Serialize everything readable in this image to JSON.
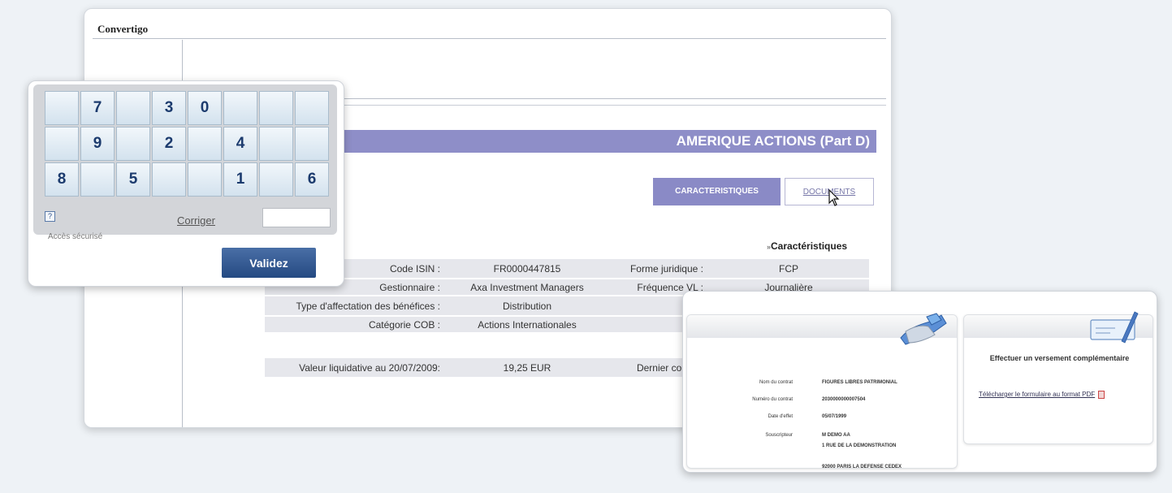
{
  "app": {
    "title": "Convertigo"
  },
  "fund": {
    "name": "AMERIQUE ACTIONS (Part D)",
    "tabs": [
      {
        "label": "CARACTERISTIQUES",
        "active": true
      },
      {
        "label": "DOCUMENTS",
        "active": false
      }
    ],
    "section_title": "Caractéristiques",
    "rows": [
      {
        "label": "Code ISIN :",
        "value": "FR0000447815",
        "label2": "Forme juridique :",
        "value2": "FCP"
      },
      {
        "label": "Gestionnaire :",
        "value": "Axa Investment Managers",
        "label2": "Fréquence VL :",
        "value2": "Journalière"
      },
      {
        "label": "Type d'affectation des bénéfices :",
        "value": "Distribution",
        "label2": "",
        "value2": ""
      },
      {
        "label": "Catégorie COB :",
        "value": "Actions Internationales",
        "label2": "",
        "value2": ""
      }
    ],
    "vl_row": {
      "label": "Valeur liquidative au 20/07/2009:",
      "value": "19,25 EUR",
      "label2": "Dernier coupon",
      "value2": ""
    }
  },
  "keypad": {
    "rows": [
      [
        "",
        "7",
        "",
        "3",
        "0",
        "",
        "",
        ""
      ],
      [
        "",
        "9",
        "",
        "2",
        "",
        "4",
        "",
        ""
      ],
      [
        "8",
        "",
        "5",
        "",
        "",
        "1",
        "",
        "6"
      ]
    ],
    "help_label": "?",
    "secure_label": "Accès sécurisé",
    "corriger_label": "Corriger",
    "code_value": "",
    "validate_label": "Validez"
  },
  "contract": {
    "rows": [
      {
        "key": "Nom du contrat",
        "value": "FIGURES LIBRES PATRIMONIAL"
      },
      {
        "key": "Numéro du contrat",
        "value": "2030000000007504"
      },
      {
        "key": "Date d'effet",
        "value": "05/07/1999"
      },
      {
        "key": "Souscripteur",
        "value": "M DEMO AA"
      }
    ],
    "address_line1": "1 RUE DE LA DEMONSTRATION",
    "address_line2": "92000 PARIS LA DEFENSE CEDEX"
  },
  "versement": {
    "title": "Effectuer un versement complémentaire",
    "link_label": "Télécharger le formulaire au format PDF"
  },
  "colors": {
    "accent": "#8e8ec8",
    "button": "#2f5590",
    "keypad_text": "#1c3b6e"
  }
}
